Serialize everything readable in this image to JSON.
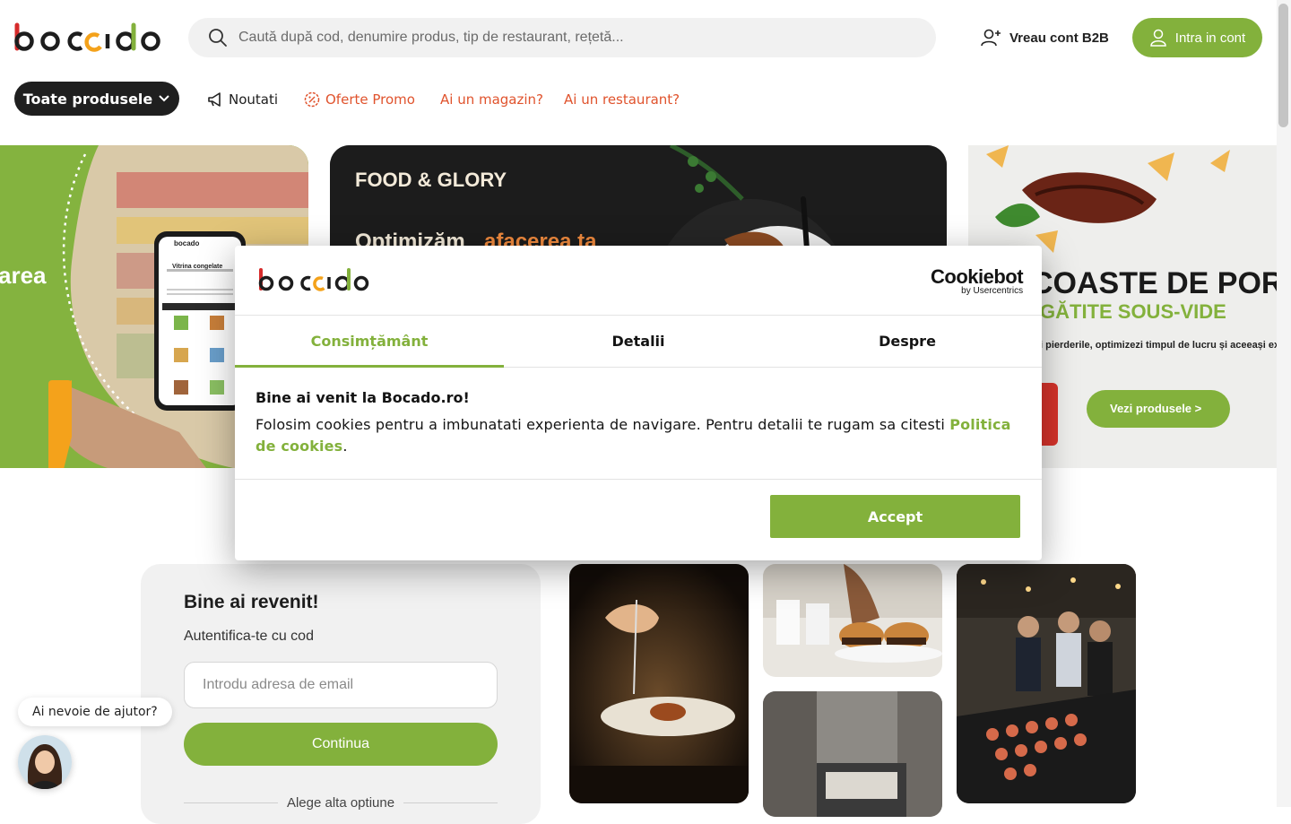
{
  "header": {
    "logo_text": "bocado",
    "search_placeholder": "Caută după cod, denumire produs, tip de restaurant, rețetă...",
    "b2b_label": "Vreau cont B2B",
    "login_label": "Intra in cont"
  },
  "nav": {
    "all_products": "Toate produsele",
    "items": [
      {
        "label": "Noutati"
      },
      {
        "label": "Oferte Promo"
      },
      {
        "label": "Ai un magazin?"
      },
      {
        "label": "Ai un restaurant?"
      }
    ]
  },
  "banners": {
    "left": {
      "text": "area",
      "phone_title": "Vitrina congelate",
      "phone_logo": "bocado"
    },
    "center": {
      "brand": "FOOD & GLORY",
      "headline_a": "Optimizăm",
      "headline_b": "afacerea ta"
    },
    "right": {
      "headline": "COASTE DE POR",
      "subheadline": "GĂTITE SOUS-VIDE",
      "body": "i pierderile, optimizezi timpul de lucru și aceeași experiență la fiecare servire.",
      "cta": "Vezi produsele >"
    }
  },
  "login_card": {
    "title": "Bine ai revenit!",
    "subtitle": "Autentifica-te cu cod",
    "email_placeholder": "Introdu adresa de email",
    "continue_label": "Continua",
    "alt_option": "Alege alta optiune"
  },
  "help": {
    "bubble": "Ai nevoie de ajutor?"
  },
  "cookie_dialog": {
    "logo_text": "bocado",
    "provider_name": "Cookiebot",
    "provider_sub": "by Usercentrics",
    "tabs": [
      {
        "label": "Consimțământ",
        "active": true
      },
      {
        "label": "Detalii",
        "active": false
      },
      {
        "label": "Despre",
        "active": false
      }
    ],
    "title": "Bine ai venit la Bocado.ro!",
    "text": "Folosim cookies pentru a imbunatati experienta de navigare. Pentru detalii te rugam sa citesti ",
    "link": "Politica de cookies",
    "text_end": ".",
    "accept_label": "Accept"
  },
  "colors": {
    "brand_green": "#83b13c",
    "accent_red": "#e0532d",
    "dark": "#1f1f1f"
  }
}
